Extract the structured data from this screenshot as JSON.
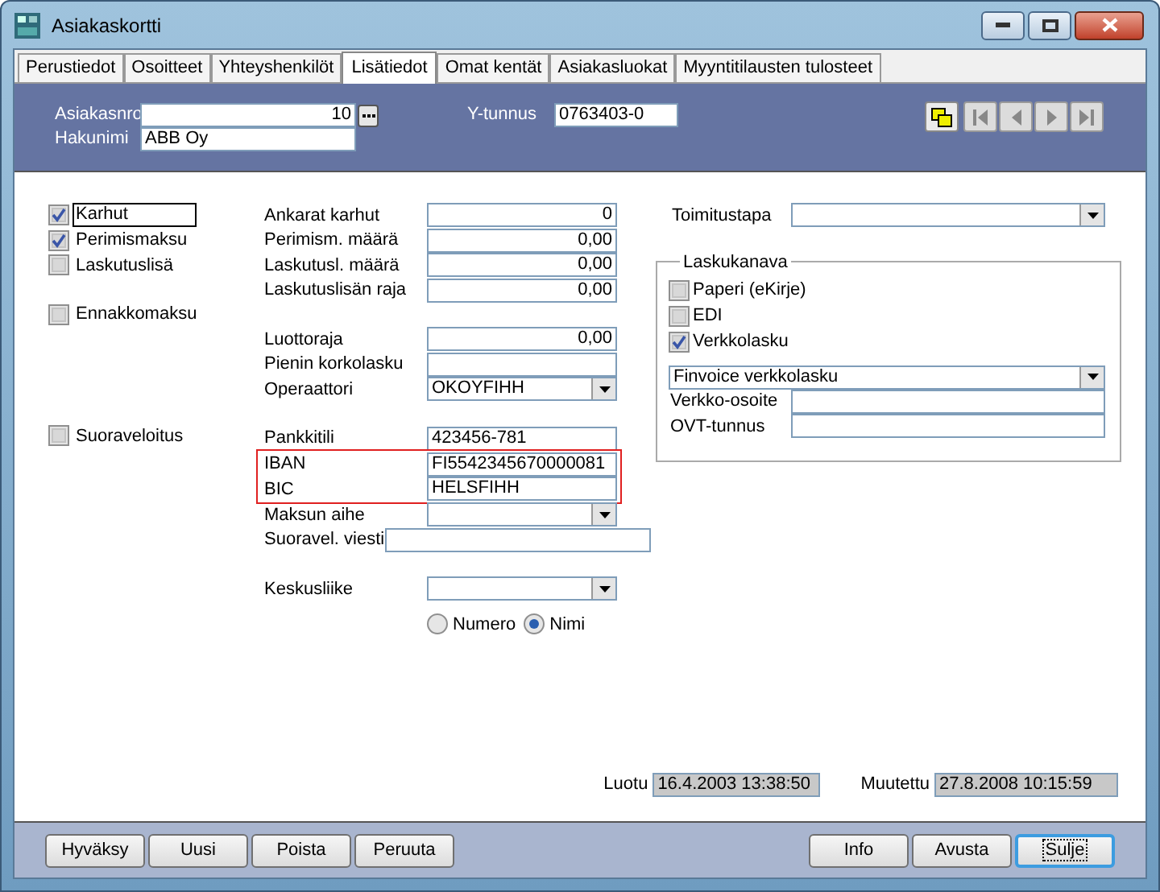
{
  "window": {
    "title": "Asiakaskortti"
  },
  "tabs": [
    {
      "label": "Perustiedot",
      "selected": false
    },
    {
      "label": "Osoitteet",
      "selected": false
    },
    {
      "label": "Yhteyshenkilöt",
      "selected": false
    },
    {
      "label": "Lisätiedot",
      "selected": true
    },
    {
      "label": "Omat kentät",
      "selected": false
    },
    {
      "label": "Asiakasluokat",
      "selected": false
    },
    {
      "label": "Myyntitilausten tulosteet",
      "selected": false
    }
  ],
  "header": {
    "customer_number_label": "Asiakasnro",
    "customer_number": "10",
    "search_name_label": "Hakunimi",
    "search_name": "ABB Oy",
    "business_id_label": "Y-tunnus",
    "business_id": "0763403-0"
  },
  "options": [
    {
      "label": "Karhut",
      "checked": true,
      "focused": true
    },
    {
      "label": "Perimismaksu",
      "checked": true,
      "focused": false
    },
    {
      "label": "Laskutuslisä",
      "checked": false,
      "focused": false
    },
    {
      "label": "Ennakkomaksu",
      "checked": false,
      "focused": false
    },
    {
      "label": "Suoraveloitus",
      "checked": false,
      "focused": false
    }
  ],
  "field_groups": [
    {
      "fields": [
        {
          "label": "Ankarat karhut",
          "value": "0",
          "kind": "number",
          "highlighted": false
        },
        {
          "label": "Perimism. määrä",
          "value": "0,00",
          "kind": "number",
          "highlighted": false
        },
        {
          "label": "Laskutusl. määrä",
          "value": "0,00",
          "kind": "number",
          "highlighted": false
        },
        {
          "label": "Laskutuslisän raja",
          "value": "0,00",
          "kind": "number",
          "highlighted": false
        }
      ]
    },
    {
      "fields": [
        {
          "label": "Luottoraja",
          "value": "0,00",
          "kind": "number",
          "highlighted": false
        },
        {
          "label": "Pienin korkolasku",
          "kind": "text",
          "highlighted": false
        },
        {
          "label": "Operaattori",
          "value": "OKOYFIHH",
          "kind": "combo",
          "highlighted": false
        }
      ]
    },
    {
      "fields": [
        {
          "label": "Pankkitili",
          "value": "423456-781",
          "kind": "text",
          "highlighted": false
        },
        {
          "label": "IBAN",
          "value": "FI5542345670000081",
          "kind": "text",
          "highlighted": true
        },
        {
          "label": "BIC",
          "value": "HELSFIHH",
          "kind": "text",
          "highlighted": true
        },
        {
          "label": "Maksun aihe",
          "kind": "combo",
          "highlighted": false
        },
        {
          "label": "Suoravel. viesti",
          "kind": "wide",
          "highlighted": false
        }
      ]
    },
    {
      "fields": [
        {
          "label": "Keskusliike",
          "kind": "combo",
          "highlighted": false
        }
      ]
    }
  ],
  "sort_by": [
    {
      "label": "Numero",
      "selected": false
    },
    {
      "label": "Nimi",
      "selected": true
    }
  ],
  "delivery_method": {
    "label": "Toimitustapa"
  },
  "invoice_channel": {
    "title": "Laskukanava",
    "options": [
      {
        "label": "Paperi (eKirje)",
        "checked": false
      },
      {
        "label": "EDI",
        "checked": false
      },
      {
        "label": "Verkkolasku",
        "checked": true
      }
    ],
    "format": "Finvoice verkkolasku",
    "fields": [
      {
        "label": "Verkko-osoite"
      },
      {
        "label": "OVT-tunnus"
      }
    ]
  },
  "timestamps": [
    {
      "label": "Luotu",
      "value": "16.4.2003 13:38:50"
    },
    {
      "label": "Muutettu",
      "value": "27.8.2008 10:15:59"
    }
  ],
  "buttons_left": [
    {
      "label": "Hyväksy",
      "default": false
    },
    {
      "label": "Uusi",
      "default": false
    },
    {
      "label": "Poista",
      "default": false
    },
    {
      "label": "Peruuta",
      "default": false
    }
  ],
  "buttons_right": [
    {
      "label": "Info",
      "default": false
    },
    {
      "label": "Avusta",
      "default": false
    },
    {
      "label": "Sulje",
      "default": true
    }
  ]
}
